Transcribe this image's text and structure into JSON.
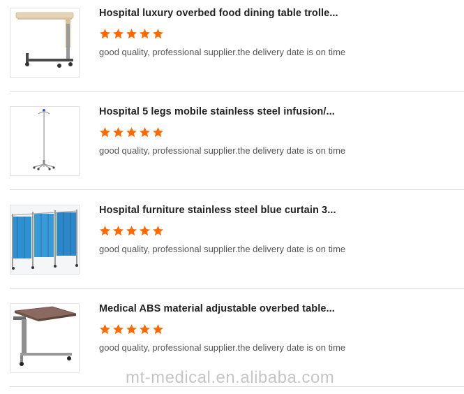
{
  "reviews": [
    {
      "title": "Hospital luxury overbed food dining table trolle...",
      "rating": 5,
      "comment": "good quality, professional supplier.the delivery date is on time",
      "image_icon": "overbed-table-photo"
    },
    {
      "title": "Hospital 5 legs mobile stainless steel infusion/...",
      "rating": 5,
      "comment": "good quality, professional supplier.the delivery date is on time",
      "image_icon": "infusion-stand-photo"
    },
    {
      "title": "Hospital furniture stainless steel blue curtain 3...",
      "rating": 5,
      "comment": "good quality, professional supplier.the delivery date is on time",
      "image_icon": "curtain-screen-photo"
    },
    {
      "title": "Medical ABS material adjustable overbed table...",
      "rating": 5,
      "comment": "good quality, professional supplier.the delivery date is on time",
      "image_icon": "abs-overbed-table-photo"
    }
  ],
  "watermark": "mt-medical.en.alibaba.com",
  "colors": {
    "star": "#ff6a00",
    "divider": "#dcdcdc",
    "title": "#222222",
    "comment": "#555555"
  }
}
